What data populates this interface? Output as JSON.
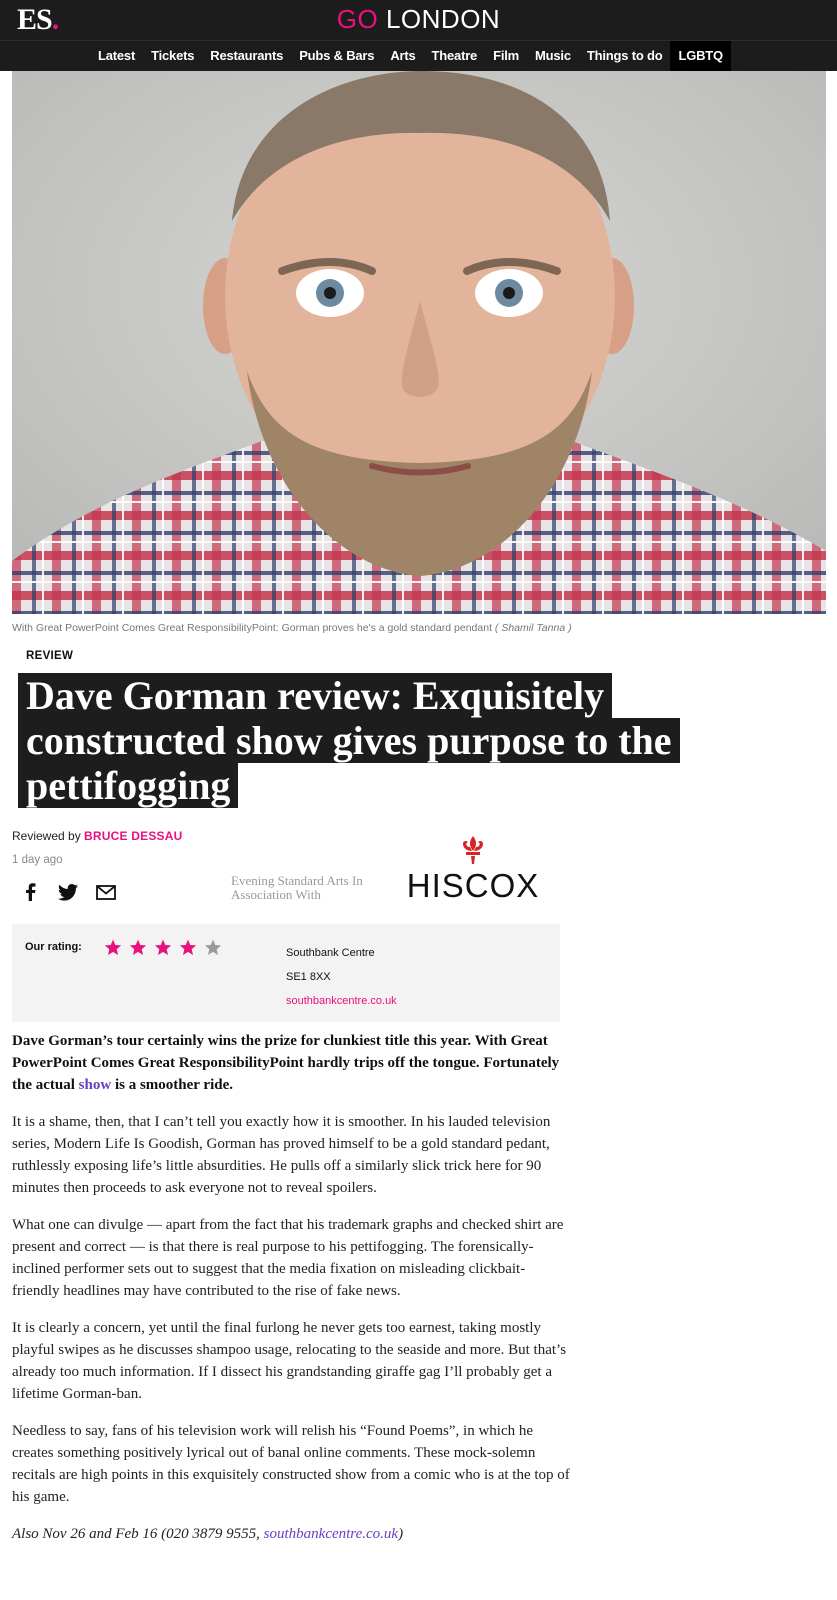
{
  "header": {
    "logo": "ES",
    "logo_dot": ".",
    "brand_go": "GO",
    "brand_london": "LONDON"
  },
  "nav": {
    "items": [
      {
        "label": "Latest"
      },
      {
        "label": "Tickets"
      },
      {
        "label": "Restaurants"
      },
      {
        "label": "Pubs & Bars"
      },
      {
        "label": "Arts"
      },
      {
        "label": "Theatre"
      },
      {
        "label": "Film"
      },
      {
        "label": "Music"
      },
      {
        "label": "Things to do"
      },
      {
        "label": "LGBTQ"
      }
    ]
  },
  "hero": {
    "caption": "With Great PowerPoint Comes Great ResponsibilityPoint: Gorman proves he's a gold standard pendant",
    "credit": "( Shamil Tanna )"
  },
  "article": {
    "kicker": "REVIEW",
    "headline": "Dave Gorman review: Exquisitely constructed show gives purpose to the pettifogging",
    "byline_prefix": "Reviewed by",
    "author": "BRUCE DESSAU",
    "timestamp": "1 day ago",
    "partner_text": "Evening Standard Arts In Association With",
    "partner_logo": "HISCOX",
    "lede_part1": "Dave Gorman’s tour certainly wins the prize for clunkiest title this year. With Great PowerPoint Comes Great ResponsibilityPoint hardly trips off the tongue. Fortunately the actual ",
    "lede_link": "show",
    "lede_part2": " is a smoother ride.",
    "paragraphs": [
      "It is a shame, then, that I can’t tell you exactly how it is smoother. In his lauded television series, Modern Life Is Goodish, Gorman has proved himself to be a gold standard pedant, ruthlessly exposing life’s little absurdities. He pulls off a similarly slick trick here for 90 minutes then proceeds to ask everyone not to reveal spoilers.",
      "What one can divulge — apart from the fact that his trademark graphs and checked shirt are present and correct — is that there is real purpose to his pettifogging. The forensically-inclined performer sets out to suggest that the media fixation on misleading clickbait-friendly headlines may have contributed to the rise of fake news.",
      "It is clearly a concern, yet until the final furlong he never gets too earnest, taking mostly playful swipes as he discusses shampoo usage, relocating to the seaside and more. But that’s already too much information. If I dissect his grandstanding giraffe gag I’ll probably get a lifetime Gorman-ban.",
      "Needless to say, fans of his television work will relish his “Found Poems”, in which he creates something positively lyrical out of banal online comments. These mock-solemn recitals are high points in this exquisitely constructed show from a comic who is at the top of his game."
    ],
    "footer_text": "Also Nov 26 and Feb 16 (020 3879 9555, ",
    "footer_link": "southbankcentre.co.uk",
    "footer_end": ")"
  },
  "rating": {
    "label": "Our rating:",
    "stars": 4,
    "max_stars": 5,
    "filled_color": "#e8117f",
    "empty_color": "#9a9a9a"
  },
  "venue": {
    "name": "Southbank Centre",
    "postcode": "SE1 8XX",
    "website": "southbankcentre.co.uk"
  },
  "colors": {
    "accent": "#e8117f",
    "header_bg": "#1c1c1c",
    "link": "#6a3fc0",
    "hiscox_red": "#d8232a"
  },
  "icons": [
    "facebook-icon",
    "twitter-icon",
    "mail-icon",
    "star-icon",
    "hiscox-fleur-icon"
  ]
}
